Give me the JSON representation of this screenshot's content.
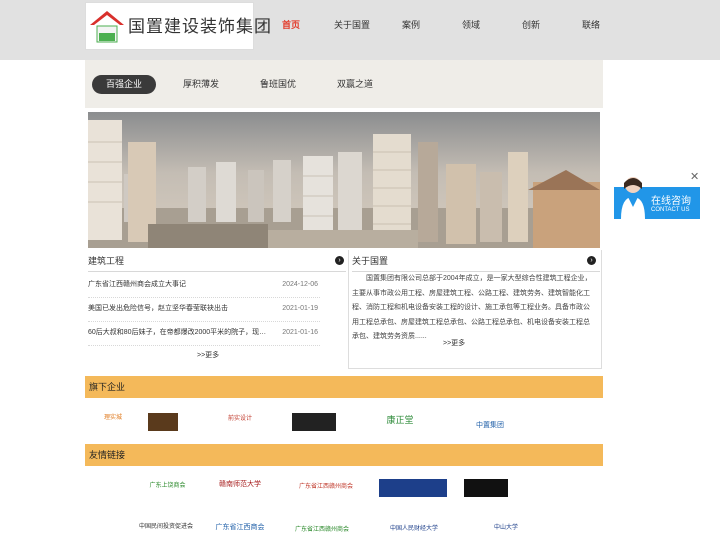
{
  "header": {
    "logo_text": "国置建设装饰集团",
    "nav": [
      "首页",
      "关于国置",
      "案例",
      "领域",
      "创新",
      "联络"
    ]
  },
  "tabs": [
    "百强企业",
    "厚积薄发",
    "鲁班国优",
    "双赢之道"
  ],
  "news": {
    "title": "建筑工程",
    "items": [
      {
        "title": "广东省江西赣州商会成立大事记",
        "date": "2024-12-06"
      },
      {
        "title": "美国已发出危险信号，赵立坚华春莹联袂出击",
        "date": "2021-01-19"
      },
      {
        "title": "60后大叔和80后妹子，在帝都爆改2000平米的院子，现实版桃…",
        "date": "2021-01-16"
      }
    ],
    "more": ">>更多"
  },
  "about": {
    "title": "关于国置",
    "text": "国置集团有限公司总部于2004年成立，是一家大型综合性建筑工程企业，主要从事市政公用工程、房屋建筑工程、公路工程、建筑劳务、建筑智能化工程、消防工程和机电设备安装工程的设计、施工承包等工程业务。具备市政公用工程总承包、房屋建筑工程总承包、公路工程总承包、机电设备安装工程总承包、建筑劳务资质......",
    "more": ">>更多"
  },
  "sections": {
    "companies_title": "旗下企业",
    "links_title": "友情链接"
  },
  "company_logos": [
    "理实城",
    "",
    "前实设计",
    "",
    "康正堂",
    "中置集团"
  ],
  "friend_links_row1": [
    "",
    "广东上饶商会",
    "赣南师范大学",
    "广东省江西赣州商会",
    "",
    ""
  ],
  "friend_links_row2": [
    "",
    "中国民间投资促进会",
    "广东省江西商会",
    "广东省江西赣州商会",
    "中国人民财经大学",
    "中山大学"
  ],
  "consult": {
    "title": "在线咨询",
    "subtitle": "CONTACT US",
    "close": "✕"
  },
  "colors": {
    "accent": "#e23b2a",
    "section_bar": "#f4b95a",
    "consult": "#2196e8"
  }
}
